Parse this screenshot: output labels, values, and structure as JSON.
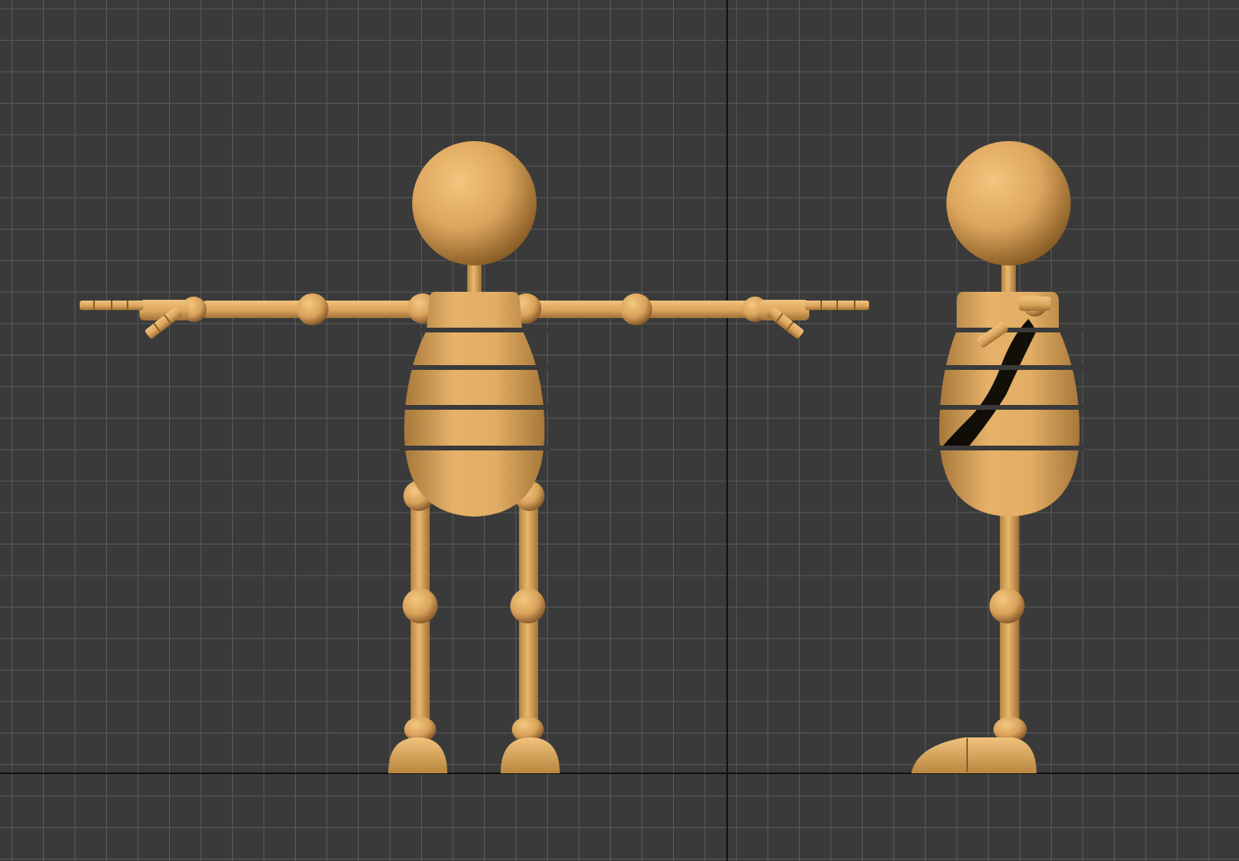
{
  "viewport": {
    "background_color": "#3a3a3a",
    "grid_color": "#5a5a5a",
    "axis_color": "#111111",
    "model_color": "#e8b46a"
  },
  "views": [
    {
      "name": "front",
      "label": ""
    },
    {
      "name": "side",
      "label": ""
    }
  ]
}
